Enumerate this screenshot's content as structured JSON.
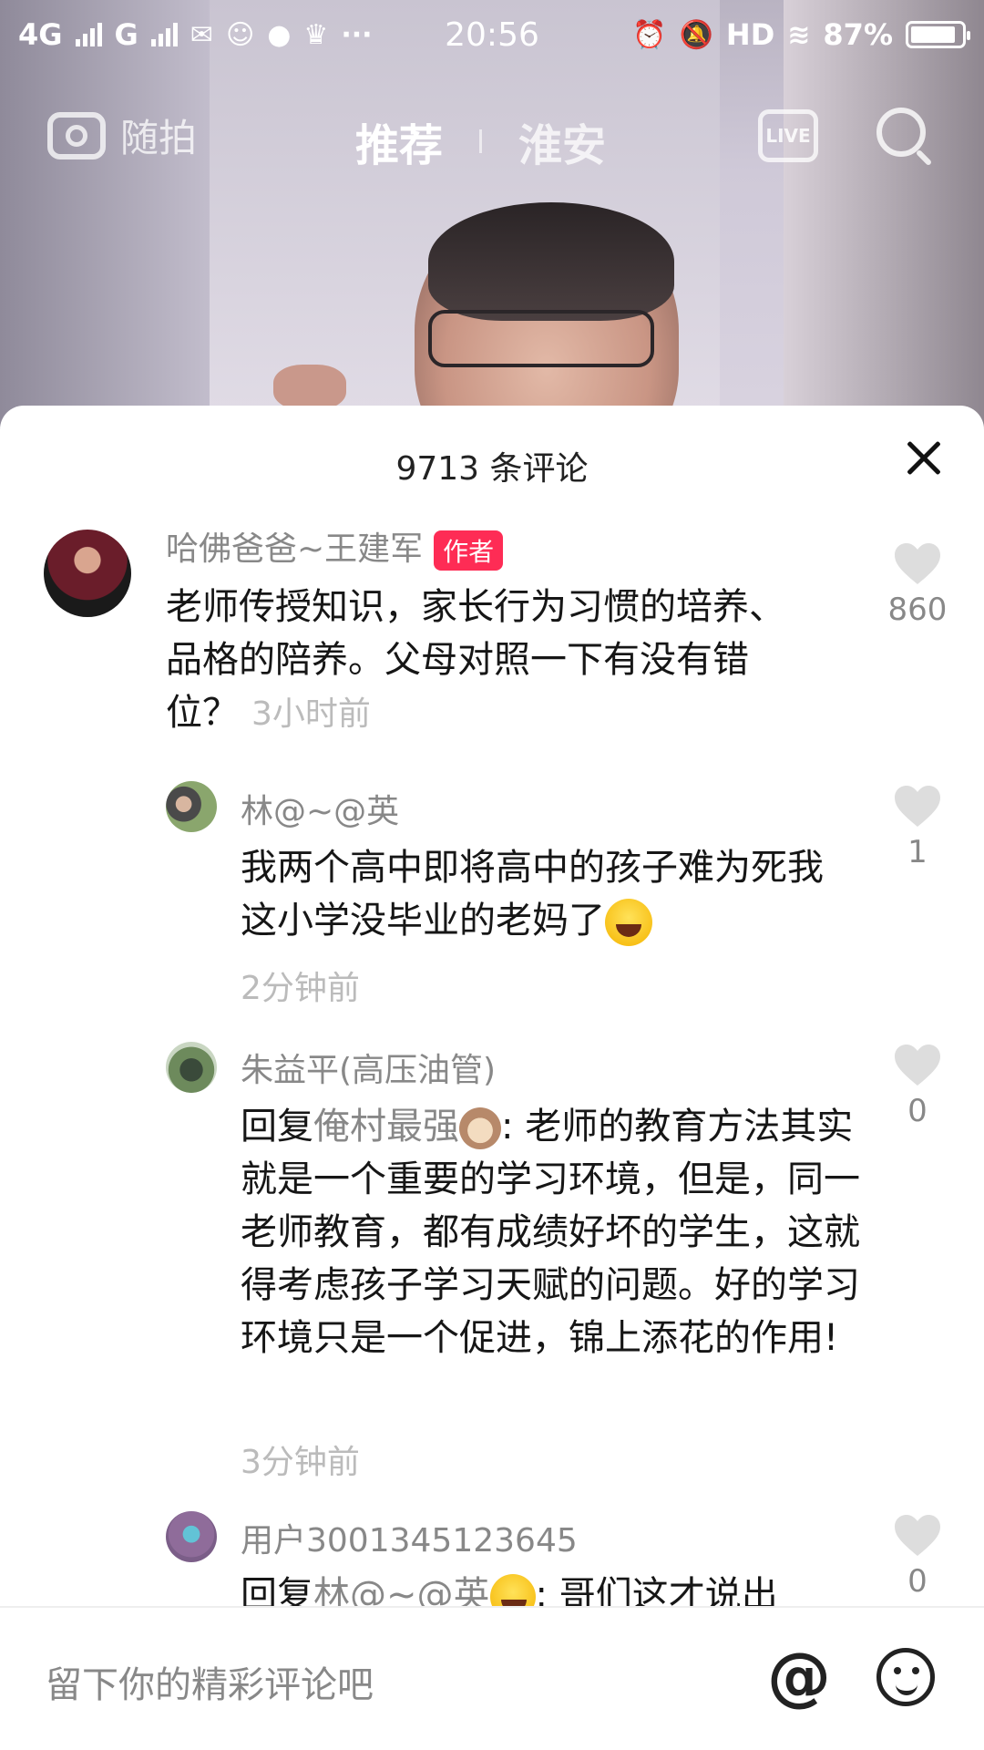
{
  "status_bar": {
    "network1": "4G",
    "network2": "G",
    "time": "20:56",
    "hd": "HD",
    "battery": "87%"
  },
  "top_nav": {
    "camera_label": "随拍",
    "tab_recommend": "推荐",
    "tab_local": "淮安",
    "live_label": "LIVE"
  },
  "comments_sheet": {
    "count_label": "9713 条评论",
    "comments": [
      {
        "username": "哈佛爸爸~王建军",
        "badge": "作者",
        "text": "老师传授知识，家长行为习惯的培养、品格的陪养。父母对照一下有没有错位？",
        "time": "3小时前",
        "likes": "860"
      },
      {
        "username": "林@~@英",
        "text": "我两个高中即将高中的孩子难为死我这小学没毕业的老妈了",
        "time": "2分钟前",
        "likes": "1"
      },
      {
        "username": "朱益平(高压油管)",
        "reply_prefix": "回复",
        "reply_target": "俺村最强",
        "text": ": 老师的教育方法其实就是一个重要的学习环境，但是，同一老师教育，都有成绩好坏的学生，这就得考虑孩子学习天赋的问题。好的学习环境只是一个促进，锦上添花的作用!",
        "time": "3分钟前",
        "likes": "0"
      },
      {
        "username": "用户3001345123645",
        "reply_prefix": "回复",
        "reply_target": "林@~@英",
        "text": ": 哥们这才说出",
        "likes": "0"
      }
    ]
  },
  "input_bar": {
    "placeholder": "留下你的精彩评论吧"
  },
  "colors": {
    "badge": "#fe2c55",
    "muted": "#888888",
    "heart": "#dddddd"
  }
}
